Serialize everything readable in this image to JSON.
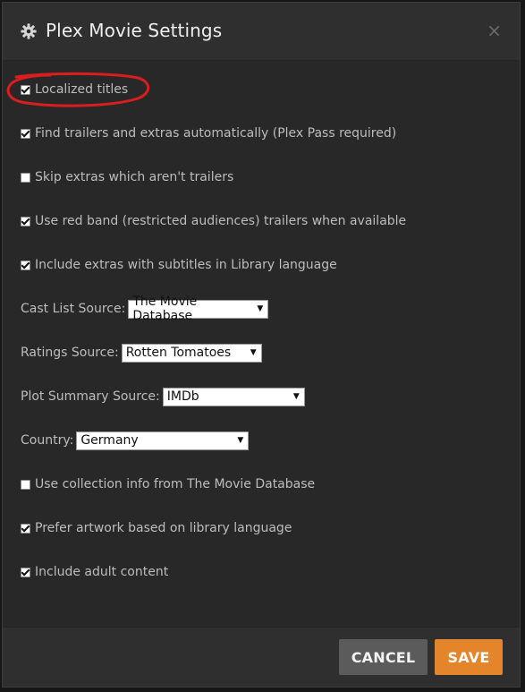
{
  "dialog": {
    "title": "Plex Movie Settings",
    "close_glyph": "×"
  },
  "settings": {
    "localized_titles": {
      "label": "Localized titles",
      "checked": true
    },
    "find_trailers": {
      "label": "Find trailers and extras automatically (Plex Pass required)",
      "checked": true
    },
    "skip_extras": {
      "label": "Skip extras which aren't trailers",
      "checked": false
    },
    "red_band": {
      "label": "Use red band (restricted audiences) trailers when available",
      "checked": true
    },
    "extras_subtitles": {
      "label": "Include extras with subtitles in Library language",
      "checked": true
    },
    "cast_list_source": {
      "label": "Cast List Source:",
      "value": "The Movie Database"
    },
    "ratings_source": {
      "label": "Ratings Source:",
      "value": "Rotten Tomatoes"
    },
    "plot_summary_source": {
      "label": "Plot Summary Source:",
      "value": "IMDb"
    },
    "country": {
      "label": "Country:",
      "value": "Germany"
    },
    "collection_info": {
      "label": "Use collection info from The Movie Database",
      "checked": false
    },
    "prefer_artwork": {
      "label": "Prefer artwork based on library language",
      "checked": true
    },
    "adult_content": {
      "label": "Include adult content",
      "checked": true
    }
  },
  "footer": {
    "cancel_label": "CANCEL",
    "save_label": "SAVE"
  },
  "colors": {
    "accent": "#e5852b",
    "annotation": "#d81e1e",
    "background": "#282828"
  },
  "icons": {
    "header": "gear-icon",
    "close": "close-icon"
  }
}
